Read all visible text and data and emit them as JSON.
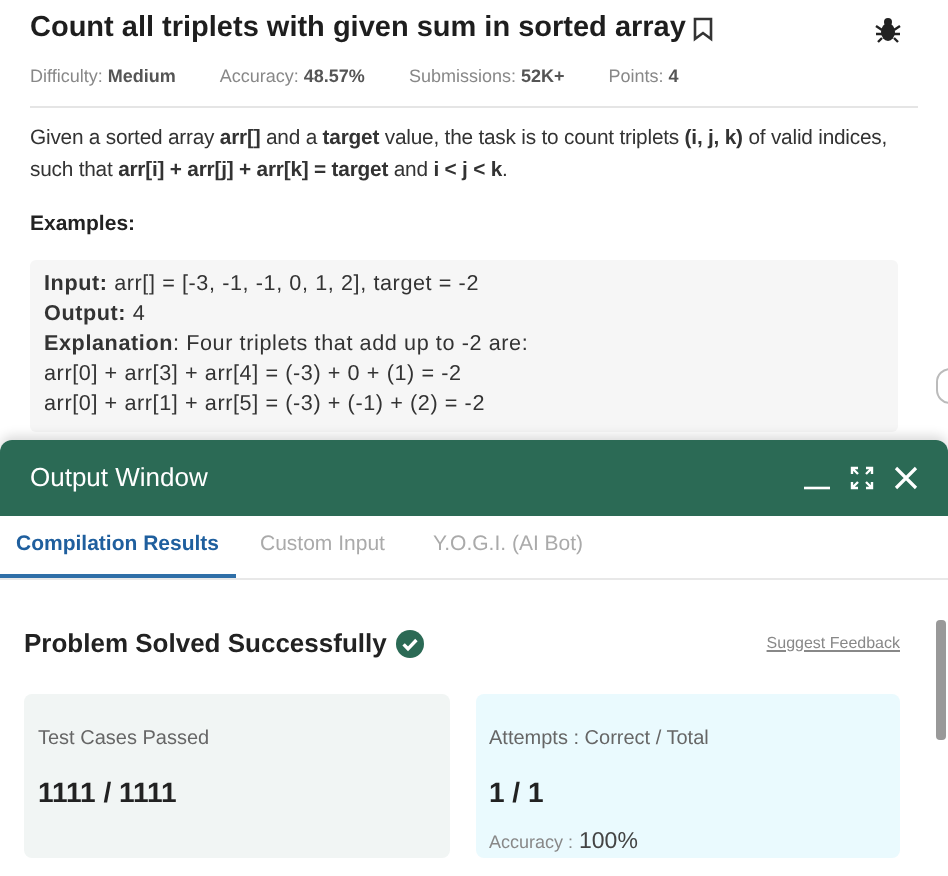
{
  "problem": {
    "title": "Count all triplets with given sum in sorted array",
    "meta": [
      {
        "label": "Difficulty:",
        "value": "Medium"
      },
      {
        "label": "Accuracy:",
        "value": "48.57%"
      },
      {
        "label": "Submissions:",
        "value": "52K+"
      },
      {
        "label": "Points:",
        "value": "4"
      }
    ],
    "description": "Given a sorted array **arr[]** and a **target** value, the task is to count triplets **(i, j, k)** of valid indices, such that **arr[i] + arr[j] + arr[k] = target** and **i < j < k**.",
    "examples_heading": "Examples:",
    "example_lines": [
      "**Input:** arr[] = [-3, -1, -1, 0, 1, 2], target = -2",
      "**Output:** 4",
      "**Explanation**: Four triplets that add up to -2 are:",
      "arr[0] + arr[3] + arr[4] = (-3) + 0 + (1) = -2",
      "arr[0] + arr[1] + arr[5] = (-3) + (-1) + (2) = -2"
    ]
  },
  "output_window": {
    "title": "Output Window",
    "tabs": [
      {
        "label": "Compilation Results",
        "selected": true
      },
      {
        "label": "Custom Input",
        "selected": false
      },
      {
        "label": "Y.O.G.I. (AI Bot)",
        "selected": false
      }
    ],
    "status": "Problem Solved Successfully",
    "feedback_link": "Suggest Feedback",
    "cards": [
      {
        "kind": "tests",
        "label": "Test Cases Passed",
        "value": "1111 / 1111"
      },
      {
        "kind": "attempts",
        "label": "Attempts : Correct / Total",
        "value": "1 / 1",
        "extra_label": "Accuracy :",
        "extra_value": "100%"
      }
    ]
  }
}
